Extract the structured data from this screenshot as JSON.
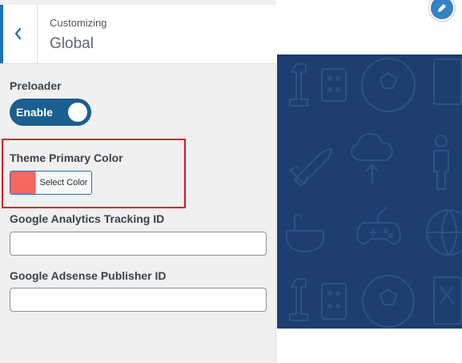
{
  "header": {
    "context_label": "Customizing",
    "section_title": "Global"
  },
  "controls": {
    "preloader": {
      "label": "Preloader",
      "toggle_text": "Enable",
      "enabled": true
    },
    "theme_color": {
      "label": "Theme Primary Color",
      "button_text": "Select Color",
      "swatch_color": "#f7665f"
    },
    "analytics": {
      "label": "Google Analytics Tracking ID",
      "value": "",
      "placeholder": ""
    },
    "adsense": {
      "label": "Google Adsense Publisher ID",
      "value": "",
      "placeholder": ""
    }
  },
  "colors": {
    "accent": "#2271b1",
    "toggle_on": "#1a5f90",
    "highlight_border": "#e0141e",
    "hero_background": "#1d3e6e"
  },
  "icons": {
    "back": "chevron-left-icon",
    "edit": "pencil-icon"
  }
}
